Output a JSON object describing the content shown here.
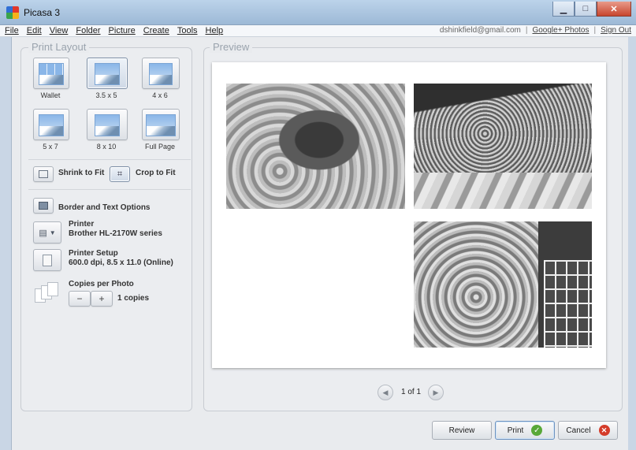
{
  "app": {
    "title": "Picasa 3"
  },
  "menubar": {
    "items": [
      "File",
      "Edit",
      "View",
      "Folder",
      "Picture",
      "Create",
      "Tools",
      "Help"
    ],
    "account_email": "dshinkfield@gmail.com",
    "google_photos_link": "Google+ Photos",
    "sign_out_link": "Sign Out",
    "separator": "|"
  },
  "print_layout": {
    "legend": "Print Layout",
    "options": [
      {
        "label": "Wallet",
        "icon": "wallet-layout-icon"
      },
      {
        "label": "3.5 x 5",
        "icon": "3-5x5-layout-icon"
      },
      {
        "label": "4 x 6",
        "icon": "4x6-layout-icon"
      },
      {
        "label": "5 x 7",
        "icon": "5x7-layout-icon"
      },
      {
        "label": "8 x 10",
        "icon": "8x10-layout-icon"
      },
      {
        "label": "Full Page",
        "icon": "full-page-layout-icon"
      }
    ],
    "selected": "3.5 x 5",
    "shrink_to_fit": "Shrink to Fit",
    "crop_to_fit": "Crop to Fit",
    "crop_selected": true,
    "border_text": "Border and Text Options",
    "printer_title": "Printer",
    "printer_name": "Brother HL-2170W series",
    "printer_setup_title": "Printer Setup",
    "printer_setup_detail": "600.0 dpi, 8.5 x 11.0 (Online)",
    "copies_title": "Copies per Photo",
    "minus": "−",
    "plus": "+",
    "copies_value": "1 copies"
  },
  "preview": {
    "legend": "Preview",
    "page_indicator": "1 of 1",
    "photos": [
      {
        "subject": "amaryllis flower (grayscale)"
      },
      {
        "subject": "pine cone / succulent bed (grayscale)"
      },
      {
        "subject": "flowers and greenhouse (grayscale)"
      }
    ]
  },
  "footer": {
    "review": "Review",
    "print": "Print",
    "cancel": "Cancel"
  }
}
